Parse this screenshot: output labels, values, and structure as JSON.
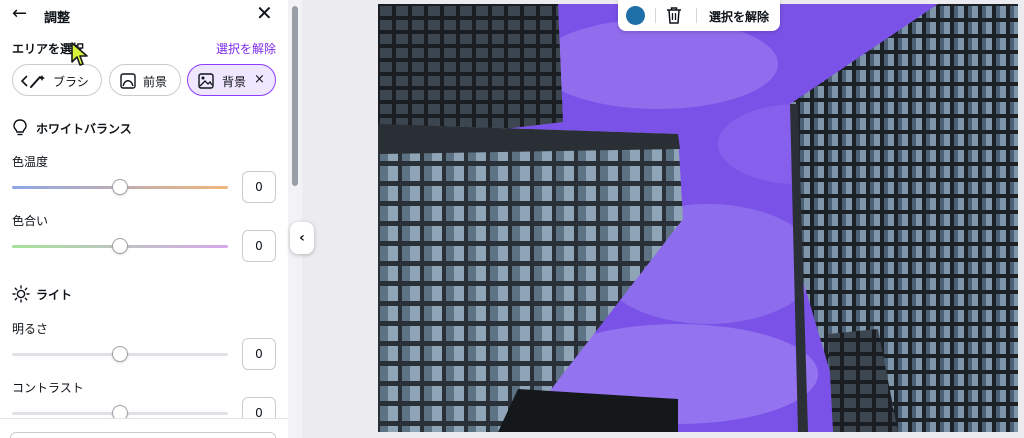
{
  "panel": {
    "title": "調整",
    "selection_label": "エリアを選択",
    "deselect_link": "選択を解除",
    "chips": {
      "brush": "ブラシ",
      "foreground": "前景",
      "background": "背景",
      "remove": "×"
    },
    "white_balance": {
      "title": "ホワイトバランス",
      "temperature": {
        "label": "色温度",
        "value": "0",
        "level": 0.5
      },
      "tint": {
        "label": "色合い",
        "value": "0",
        "level": 0.5
      }
    },
    "light": {
      "title": "ライト",
      "brightness": {
        "label": "明るさ",
        "value": "0",
        "level": 0.5
      },
      "contrast": {
        "label": "コントラスト",
        "value": "0",
        "level": 0.5
      }
    }
  },
  "canvas_toolbar": {
    "deselect_label": "選択を解除",
    "color": "#1e6ea8"
  },
  "colors": {
    "accent": "#8b3dff",
    "selection_overlay": "#7b52e8"
  },
  "icons": [
    "arrow-left-icon",
    "close-icon",
    "brush-icon",
    "foreground-icon",
    "background-icon",
    "bulb-icon",
    "sun-icon",
    "chevron-left-icon",
    "trash-icon",
    "mouse-cursor-icon"
  ]
}
